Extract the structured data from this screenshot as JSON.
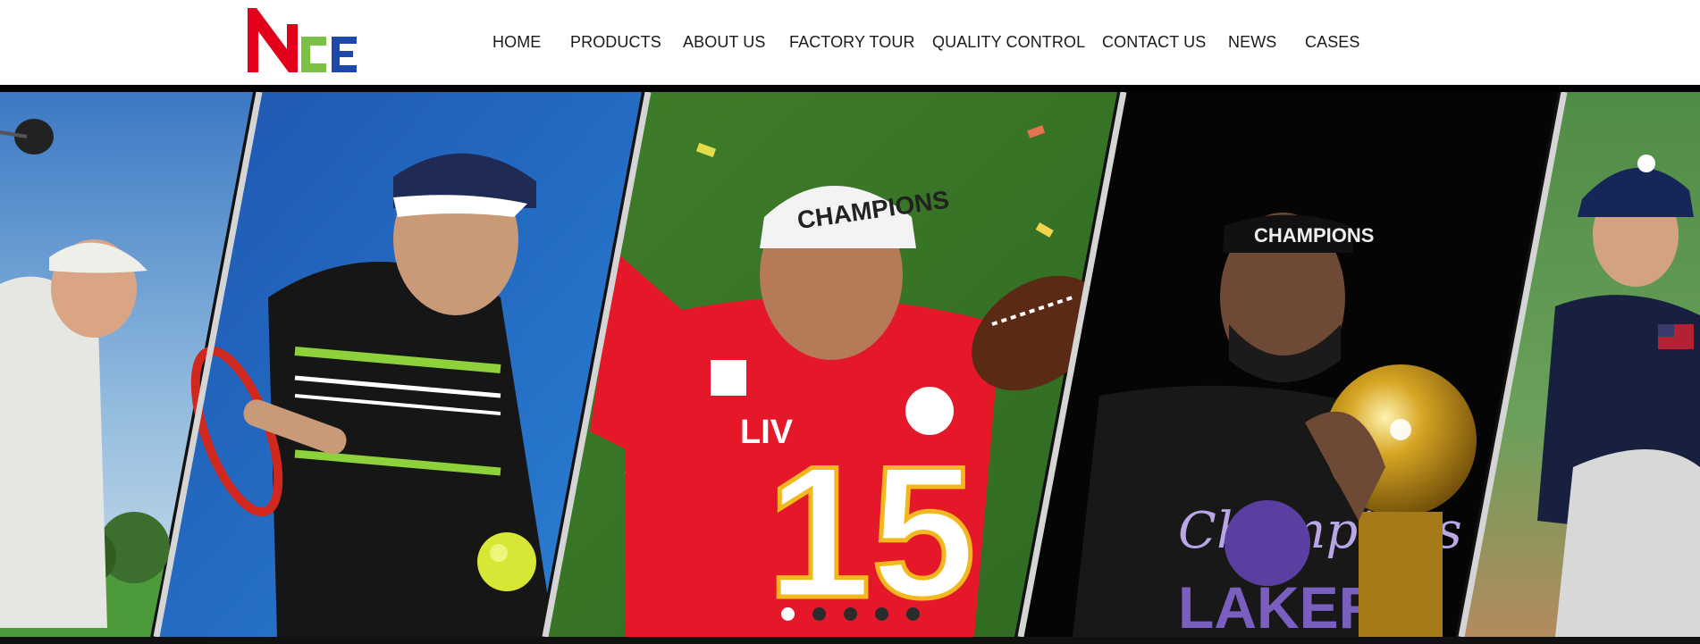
{
  "header": {
    "logo": {
      "text": "NCE",
      "icon": "nce-logo",
      "colors": [
        "#e2001a",
        "#7ac143",
        "#1d4aa8"
      ]
    },
    "nav": [
      {
        "label": "HOME"
      },
      {
        "label": "PRODUCTS"
      },
      {
        "label": "ABOUT US"
      },
      {
        "label": "FACTORY TOUR"
      },
      {
        "label": "QUALITY CONTROL"
      },
      {
        "label": "CONTACT US"
      },
      {
        "label": "NEWS"
      },
      {
        "label": "CASES"
      }
    ]
  },
  "hero": {
    "panels": [
      {
        "name": "golfer-photo"
      },
      {
        "name": "tennis-player-photo"
      },
      {
        "name": "football-player-photo",
        "jersey_number": "15",
        "cap_text": "CHAMPIONS",
        "patch_text": "LIV"
      },
      {
        "name": "basketball-champion-photo",
        "cap_text": "CHAMPIONS",
        "shirt_text": "LAKERS",
        "script_text": "Champions"
      },
      {
        "name": "baseball-pitcher-photo"
      }
    ],
    "carousel": {
      "count": 5,
      "active_index": 0
    }
  },
  "colors": {
    "accent_red": "#e2001a",
    "accent_green": "#7ac143",
    "accent_blue": "#1d4aa8"
  }
}
